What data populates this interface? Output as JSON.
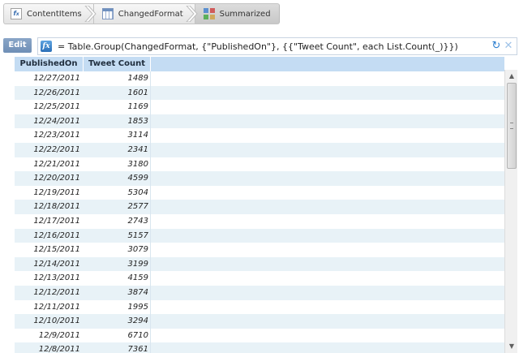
{
  "breadcrumb": {
    "steps": [
      {
        "label": "ContentItems",
        "icon": "formula-step-icon"
      },
      {
        "label": "ChangedFormat",
        "icon": "table-step-icon"
      },
      {
        "label": "Summarized",
        "icon": "grouped-step-icon"
      }
    ]
  },
  "formula_bar": {
    "edit_label": "Edit",
    "fx_label": "fx",
    "formula": "= Table.Group(ChangedFormat, {\"PublishedOn\"}, {{\"Tweet Count\", each List.Count(_)}})",
    "refresh_icon": "refresh-icon",
    "close_icon": "close-icon"
  },
  "table": {
    "columns": [
      "PublishedOn",
      "Tweet Count"
    ],
    "rows": [
      [
        "12/27/2011",
        "1489"
      ],
      [
        "12/26/2011",
        "1601"
      ],
      [
        "12/25/2011",
        "1169"
      ],
      [
        "12/24/2011",
        "1853"
      ],
      [
        "12/23/2011",
        "3114"
      ],
      [
        "12/22/2011",
        "2341"
      ],
      [
        "12/21/2011",
        "3180"
      ],
      [
        "12/20/2011",
        "4599"
      ],
      [
        "12/19/2011",
        "5304"
      ],
      [
        "12/18/2011",
        "2577"
      ],
      [
        "12/17/2011",
        "2743"
      ],
      [
        "12/16/2011",
        "5157"
      ],
      [
        "12/15/2011",
        "3079"
      ],
      [
        "12/14/2011",
        "3199"
      ],
      [
        "12/13/2011",
        "4159"
      ],
      [
        "12/12/2011",
        "3874"
      ],
      [
        "12/11/2011",
        "1995"
      ],
      [
        "12/10/2011",
        "3294"
      ],
      [
        "12/9/2011",
        "6710"
      ],
      [
        "12/8/2011",
        "7361"
      ]
    ]
  },
  "colors": {
    "header_bg": "#c4dcf3",
    "alt_row_bg": "#e8f2f7",
    "accent": "#2a6fb8"
  }
}
